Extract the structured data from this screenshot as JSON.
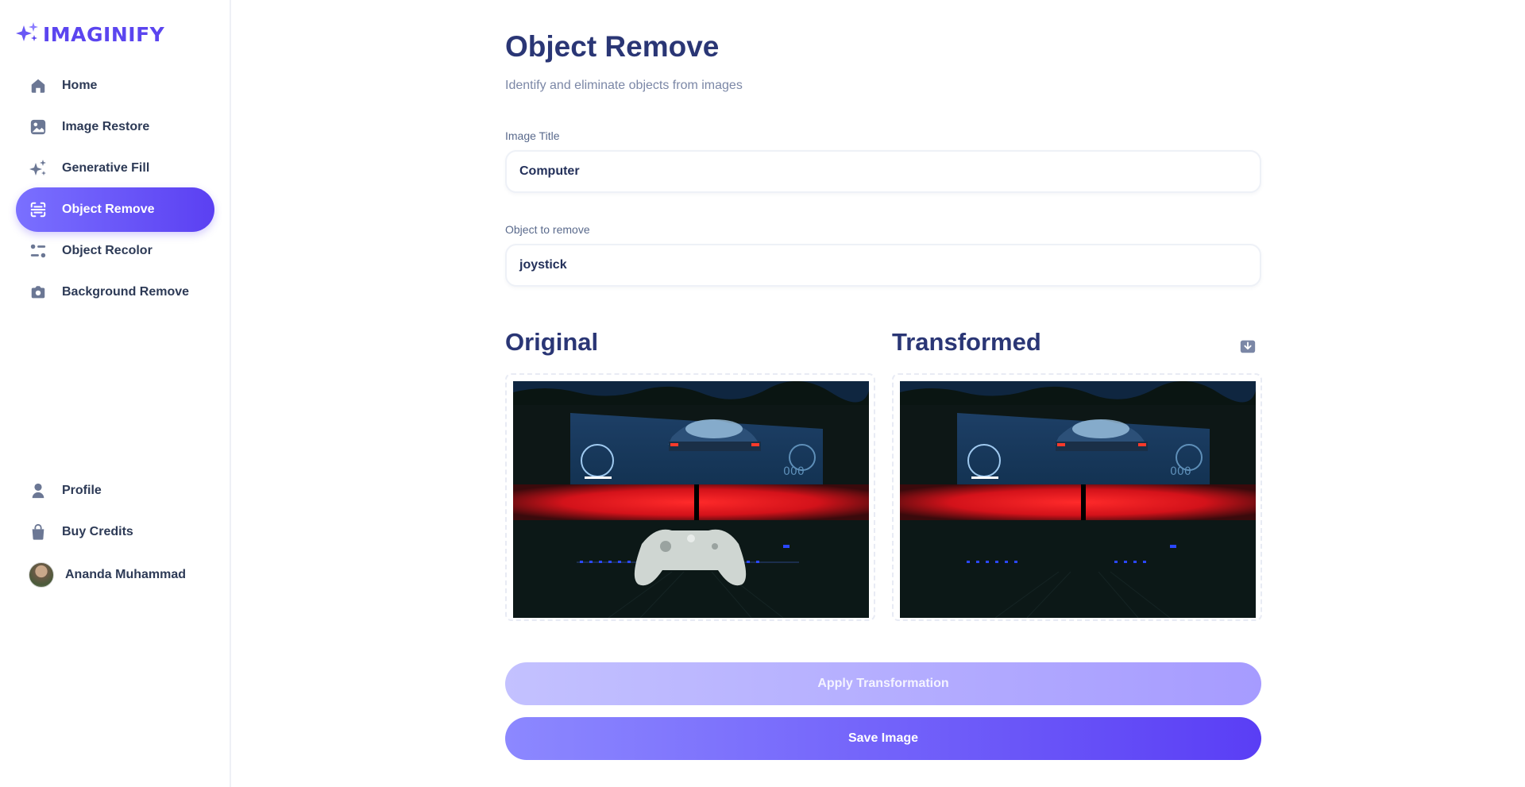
{
  "app": {
    "name": "IMAGINIFY"
  },
  "sidebar": {
    "items": [
      {
        "label": "Home",
        "icon": "home-icon",
        "active": false
      },
      {
        "label": "Image Restore",
        "icon": "image-icon",
        "active": false
      },
      {
        "label": "Generative Fill",
        "icon": "sparkles-icon",
        "active": false
      },
      {
        "label": "Object Remove",
        "icon": "scan-icon",
        "active": true
      },
      {
        "label": "Object Recolor",
        "icon": "filter-icon",
        "active": false
      },
      {
        "label": "Background Remove",
        "icon": "camera-icon",
        "active": false
      }
    ],
    "bottom_items": [
      {
        "label": "Profile",
        "icon": "user-icon"
      },
      {
        "label": "Buy Credits",
        "icon": "bag-icon"
      }
    ],
    "user": {
      "name": "Ananda Muhammad"
    }
  },
  "main": {
    "title": "Object Remove",
    "subtitle": "Identify and eliminate objects from images",
    "image_title": {
      "label": "Image Title",
      "value": "Computer"
    },
    "object_to_remove": {
      "label": "Object to remove",
      "value": "joystick"
    },
    "original_heading": "Original",
    "transformed_heading": "Transformed",
    "apply_button": "Apply Transformation",
    "save_button": "Save Image"
  },
  "colors": {
    "accent": "#5b40f2",
    "accent_light": "#7a70ff",
    "heading": "#2a3675",
    "icon": "#6b7794"
  }
}
